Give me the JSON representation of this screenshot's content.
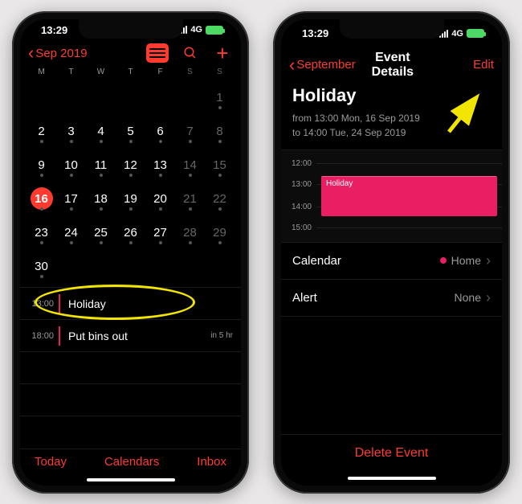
{
  "status": {
    "time": "13:29",
    "network": "4G"
  },
  "left": {
    "back_label": "Sep 2019",
    "weekdays": [
      "M",
      "T",
      "W",
      "T",
      "F",
      "S",
      "S"
    ],
    "days": [
      {
        "n": "",
        "wk": false
      },
      {
        "n": "",
        "wk": false
      },
      {
        "n": "",
        "wk": false
      },
      {
        "n": "",
        "wk": false
      },
      {
        "n": "",
        "wk": false
      },
      {
        "n": "",
        "wk": true
      },
      {
        "n": "1",
        "wk": true,
        "dot": true
      },
      {
        "n": "2",
        "dot": true
      },
      {
        "n": "3",
        "dot": true
      },
      {
        "n": "4",
        "dot": true
      },
      {
        "n": "5",
        "dot": true
      },
      {
        "n": "6",
        "dot": true
      },
      {
        "n": "7",
        "wk": true,
        "dot": true
      },
      {
        "n": "8",
        "wk": true,
        "dot": true
      },
      {
        "n": "9",
        "dot": true
      },
      {
        "n": "10",
        "dot": true
      },
      {
        "n": "11",
        "dot": true
      },
      {
        "n": "12",
        "dot": true
      },
      {
        "n": "13",
        "dot": true
      },
      {
        "n": "14",
        "wk": true,
        "dot": true
      },
      {
        "n": "15",
        "wk": true,
        "dot": true
      },
      {
        "n": "16",
        "dot": true,
        "sel": true
      },
      {
        "n": "17",
        "dot": true
      },
      {
        "n": "18",
        "dot": true
      },
      {
        "n": "19",
        "dot": true
      },
      {
        "n": "20",
        "dot": true
      },
      {
        "n": "21",
        "wk": true,
        "dot": true
      },
      {
        "n": "22",
        "wk": true,
        "dot": true
      },
      {
        "n": "23",
        "dot": true
      },
      {
        "n": "24",
        "dot": true
      },
      {
        "n": "25",
        "dot": true
      },
      {
        "n": "26",
        "dot": true
      },
      {
        "n": "27",
        "dot": true
      },
      {
        "n": "28",
        "wk": true,
        "dot": true
      },
      {
        "n": "29",
        "wk": true,
        "dot": true
      },
      {
        "n": "30",
        "dot": true
      },
      {
        "n": ""
      },
      {
        "n": ""
      },
      {
        "n": ""
      },
      {
        "n": ""
      },
      {
        "n": ""
      },
      {
        "n": ""
      }
    ],
    "events": [
      {
        "time": "13:00",
        "title": "Holiday",
        "in": ""
      },
      {
        "time": "18:00",
        "title": "Put bins out",
        "in": "in 5 hr"
      }
    ],
    "toolbar": {
      "today": "Today",
      "calendars": "Calendars",
      "inbox": "Inbox"
    }
  },
  "right": {
    "back_label": "September",
    "nav_title": "Event Details",
    "edit_label": "Edit",
    "event_title": "Holiday",
    "from_line": "from 13:00 Mon, 16 Sep 2019",
    "to_line": "to 14:00 Tue, 24 Sep 2019",
    "timeline_hours": [
      "12:00",
      "13:00",
      "14:00",
      "15:00"
    ],
    "timeline_block_label": "Holiday",
    "rows": {
      "calendar_label": "Calendar",
      "calendar_value": "Home",
      "alert_label": "Alert",
      "alert_value": "None"
    },
    "delete_label": "Delete Event"
  }
}
